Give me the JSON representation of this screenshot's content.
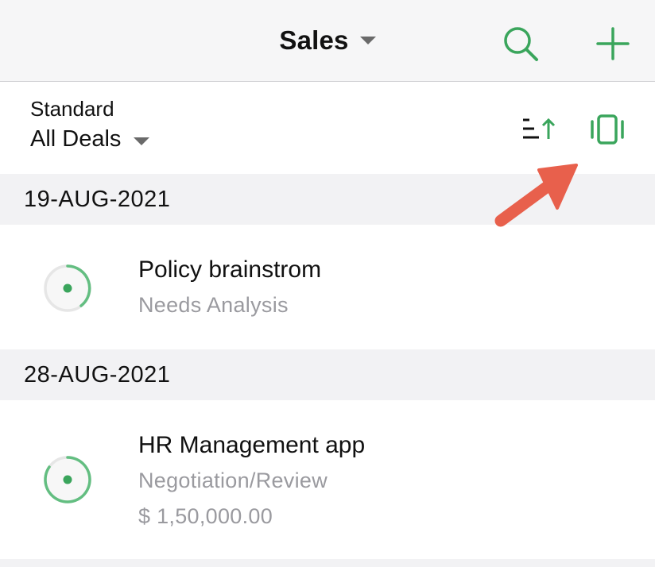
{
  "navbar": {
    "title": "Sales",
    "search_icon": "search-icon",
    "add_icon": "plus-icon",
    "accent_color": "#3aa55c"
  },
  "view_selector": {
    "label": "Standard",
    "value": "All Deals",
    "sort_icon": "sort-ascending-icon",
    "kanban_icon": "kanban-view-icon"
  },
  "sections": [
    {
      "date": "19-AUG-2021",
      "deals": [
        {
          "name": "Policy brainstrom",
          "stage": "Needs Analysis",
          "amount": "",
          "progress": 0.3
        }
      ]
    },
    {
      "date": "28-AUG-2021",
      "deals": [
        {
          "name": "HR Management app",
          "stage": "Negotiation/Review",
          "amount": "$ 1,50,000.00",
          "progress": 0.7
        }
      ]
    }
  ],
  "annotation": {
    "arrow_color": "#e8604c",
    "arrow_icon": "pointer-arrow"
  }
}
